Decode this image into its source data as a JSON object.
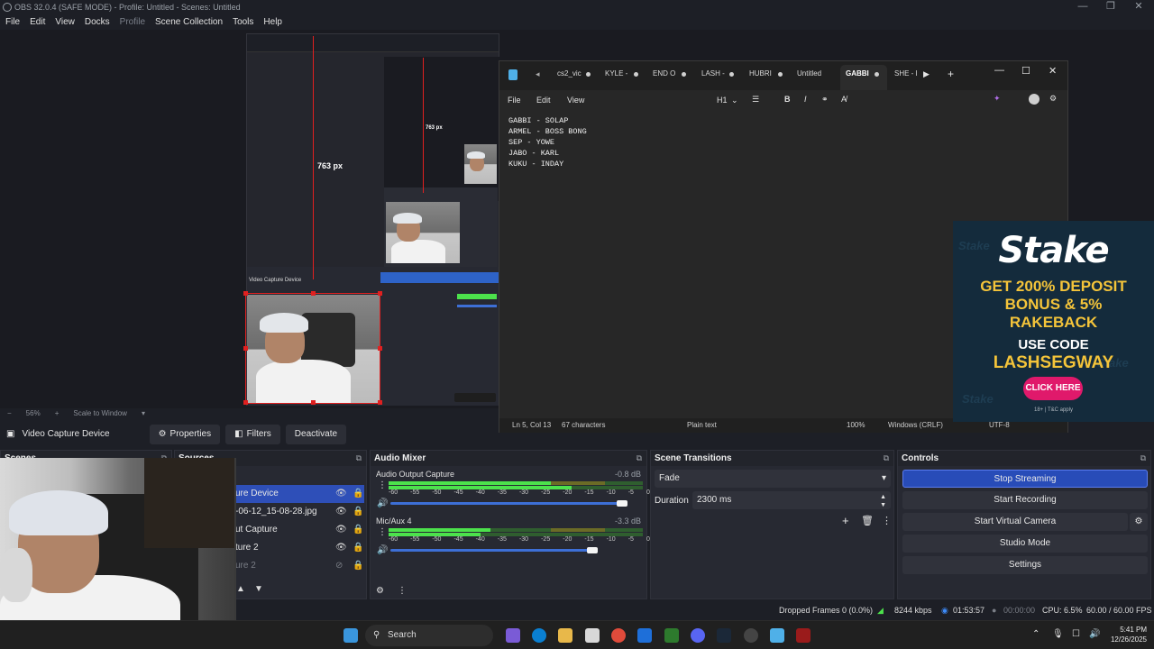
{
  "window": {
    "title": "OBS 32.0.4 (SAFE MODE) - Profile: Untitled - Scenes: Untitled",
    "minimize": "—",
    "maximize": "❐",
    "close": "✕"
  },
  "menu": {
    "file": "File",
    "edit": "Edit",
    "view": "View",
    "docks": "Docks",
    "profile": "Profile",
    "scene_collection": "Scene Collection",
    "tools": "Tools",
    "help": "Help"
  },
  "preview": {
    "measure_label": "763 px",
    "nested_measure_label": "763 px",
    "zoom_level": "56%",
    "zoom_mode": "Scale to Window"
  },
  "source_toolbar": {
    "source_name": "Video Capture Device",
    "properties": "Properties",
    "filters": "Filters",
    "deactivate": "Deactivate"
  },
  "scenes_dock": {
    "title": "Scenes"
  },
  "sources_dock": {
    "title": "Sources",
    "items": [
      {
        "label": "ure Device"
      },
      {
        "label": "-06-12_15-08-28.jpg"
      },
      {
        "label": "ut Capture"
      },
      {
        "label": "ture 2"
      },
      {
        "label": "ure 2"
      }
    ]
  },
  "audio_mixer": {
    "title": "Audio Mixer",
    "channels": [
      {
        "name": "Audio Output Capture",
        "db": "-0.8 dB",
        "level": 0.8,
        "volume": 0.95
      },
      {
        "name": "Mic/Aux 4",
        "db": "-3.3 dB",
        "level": 0.4,
        "volume": 0.83
      }
    ],
    "scale": [
      "-60",
      "-55",
      "-50",
      "-45",
      "-40",
      "-35",
      "-30",
      "-25",
      "-20",
      "-15",
      "-10",
      "-5",
      "0"
    ]
  },
  "scene_transitions": {
    "title": "Scene Transitions",
    "transition": "Fade",
    "duration_label": "Duration",
    "duration_value": "2300 ms"
  },
  "controls": {
    "title": "Controls",
    "stop_streaming": "Stop Streaming",
    "start_recording": "Start Recording",
    "start_virtual_camera": "Start Virtual Camera",
    "studio_mode": "Studio Mode",
    "settings": "Settings"
  },
  "status": {
    "dropped_frames": "Dropped Frames 0 (0.0%)",
    "bitrate": "8244 kbps",
    "stream_time": "01:53:57",
    "record_time": "00:00:00",
    "cpu": "CPU: 6.5%",
    "fps": "60.00 / 60.00 FPS"
  },
  "taskbar": {
    "search": "Search",
    "time": "5:41 PM",
    "date": "12/26/2025"
  },
  "notepad": {
    "tabs": [
      {
        "label": "cs2_vic"
      },
      {
        "label": "KYLE -"
      },
      {
        "label": "END O"
      },
      {
        "label": "LASH -"
      },
      {
        "label": "HUBRI"
      },
      {
        "label": "Untitled"
      },
      {
        "label": "GABBI"
      },
      {
        "label": "SHE - I"
      }
    ],
    "menu": {
      "file": "File",
      "edit": "Edit",
      "view": "View",
      "heading": "H1"
    },
    "lines": [
      "GABBI - SOLAP",
      "ARMEL - BOSS BONG",
      "SEP - YOWE",
      "JABO - KARL",
      "KUKU - INDAY"
    ],
    "status": {
      "position": "Ln 5, Col 13",
      "chars": "67 characters",
      "format": "Plain text",
      "zoom": "100%",
      "line_ending": "Windows (CRLF)",
      "encoding": "UTF-8"
    }
  },
  "ad": {
    "brand": "Stake",
    "line1": "GET 200% DEPOSIT",
    "line2": "BONUS & 5%",
    "line3": "RAKEBACK",
    "code_label": "USE CODE",
    "code_value": "LASHSEGWAY",
    "cta": "CLICK HERE",
    "fine_print": "18+ | T&C apply"
  },
  "colors": {
    "accent": "#284cb8",
    "bg": "#1d1f26",
    "dock": "#272932",
    "red": "#e02020",
    "meter_green": "#4ce24c"
  }
}
